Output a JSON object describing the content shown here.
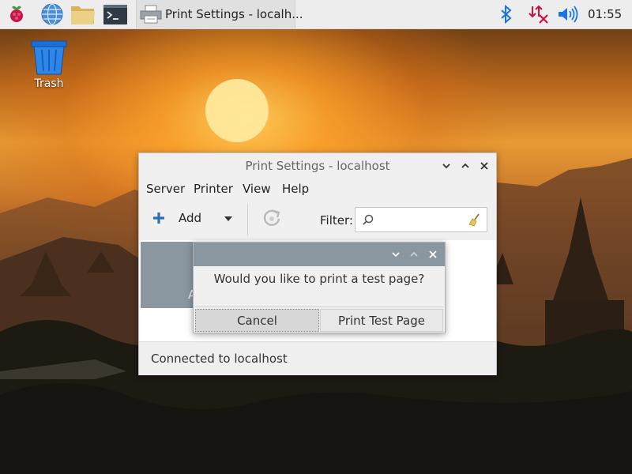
{
  "taskbar": {
    "launchers": [
      {
        "name": "raspberry-menu-icon"
      },
      {
        "name": "web-browser-icon"
      },
      {
        "name": "file-manager-icon"
      },
      {
        "name": "terminal-icon"
      }
    ],
    "task": {
      "label": "Print Settings - localh...",
      "icon": "printer-icon"
    },
    "tray": {
      "bluetooth_icon": "bluetooth-icon",
      "network_icon": "network-disconnected-icon",
      "volume_icon": "volume-icon",
      "clock": "01:55"
    }
  },
  "desktop": {
    "trash_label": "Trash"
  },
  "window": {
    "title": "Print Settings - localhost",
    "menu": [
      "Server",
      "Printer",
      "View",
      "Help"
    ],
    "toolbar": {
      "add_label": "Add",
      "filter_label": "Filter:",
      "filter_value": ""
    },
    "printer_tile_fragment": "A",
    "status": "Connected to localhost"
  },
  "dialog": {
    "message": "Would you like to print a test page?",
    "cancel_label": "Cancel",
    "print_label": "Print Test Page"
  },
  "colors": {
    "panel_bg": "#ededed",
    "window_bg": "#f0f0f0",
    "selected_tile": "#8a96a0",
    "bluetooth": "#1a73e8",
    "network_error": "#d0103a"
  }
}
